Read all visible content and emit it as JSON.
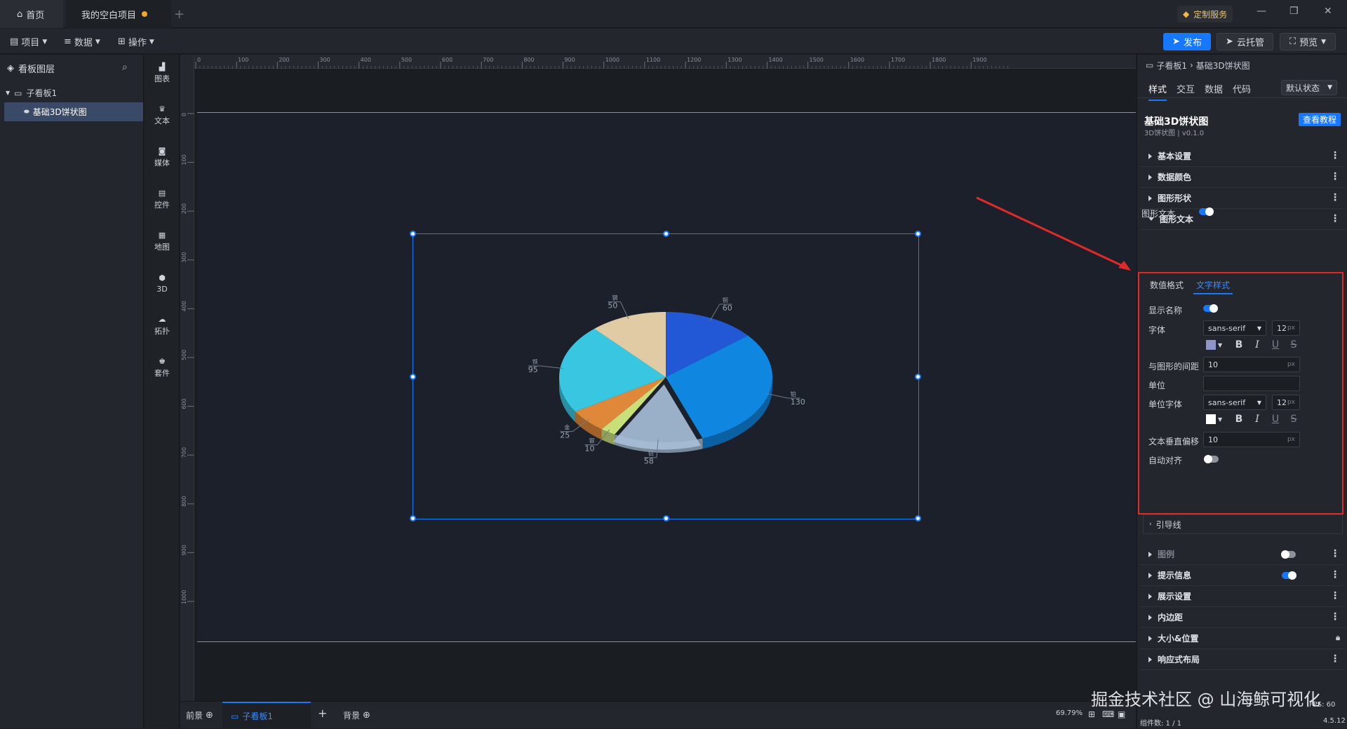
{
  "titlebar": {
    "home_tab": "首页",
    "project_tab": "我的空白项目",
    "custom_service": "定制服务"
  },
  "toolbar": {
    "menus": [
      "项目",
      "数据",
      "操作"
    ],
    "publish": "发布",
    "cloud": "云托管",
    "preview": "预览"
  },
  "layers": {
    "title": "看板图层",
    "board": "子看板1",
    "item": "基础3D饼状图"
  },
  "components": [
    "图表",
    "文本",
    "媒体",
    "控件",
    "地图",
    "3D",
    "拓扑",
    "套件"
  ],
  "ruler": {
    "h_ticks": [
      "0",
      "100",
      "200",
      "300",
      "400",
      "500",
      "600",
      "700",
      "800",
      "900",
      "1000",
      "1100",
      "1200",
      "1300",
      "1400",
      "1500",
      "1600",
      "1700",
      "1800",
      "1900"
    ],
    "v_ticks": [
      "0",
      "100",
      "200",
      "300",
      "400",
      "500",
      "600",
      "700",
      "800",
      "900",
      "1000"
    ]
  },
  "chart_data": {
    "type": "pie",
    "variant": "3d",
    "slices": [
      {
        "name": "铜",
        "value": 60,
        "color": "#2257d6"
      },
      {
        "name": "铂",
        "value": 130,
        "color": "#0f86e0"
      },
      {
        "name": "钻",
        "value": 58,
        "color": "#a8bfd9"
      },
      {
        "name": "银",
        "value": 10,
        "color": "#c9e07a"
      },
      {
        "name": "金",
        "value": 25,
        "color": "#e0883a"
      },
      {
        "name": "铁",
        "value": 95,
        "color": "#38c6e0"
      },
      {
        "name": "钢",
        "value": 50,
        "color": "#e1cba4"
      }
    ]
  },
  "bottombar": {
    "foreground": "前景",
    "board": "子看板1",
    "add": "+",
    "background": "背景",
    "zoom": "69.79%",
    "components_count": "组件数: 1 / 1",
    "version": "4.5.12",
    "fps": "FPS: 60"
  },
  "panel": {
    "breadcrumb_root": "子看板1",
    "breadcrumb_item": "基础3D饼状图",
    "tabs": [
      "样式",
      "交互",
      "数据",
      "代码"
    ],
    "state": "默认状态",
    "title": "基础3D饼状图",
    "subtitle": "3D饼状图 | v0.1.0",
    "tutorial": "查看教程",
    "sections_top": [
      "基本设置",
      "数据颜色",
      "图形形状",
      "图形文本"
    ],
    "graph_text_label": "图形文本",
    "inner_tabs": [
      "数值格式",
      "文字样式"
    ],
    "show_name": "显示名称",
    "font_label": "字体",
    "font_value": "sans-serif",
    "font_size": "12",
    "unit_px": "px",
    "gap_label": "与图形的间距",
    "gap_value": "10",
    "unit_label": "单位",
    "unit_value": "",
    "unit_font_label": "单位字体",
    "unit_font_value": "sans-serif",
    "unit_font_size": "12",
    "offset_label": "文本垂直偏移",
    "offset_value": "10",
    "auto_align": "自动对齐",
    "guide": "引导线",
    "sections_bottom": [
      "图例",
      "提示信息",
      "展示设置",
      "内边距",
      "大小&位置",
      "响应式布局"
    ],
    "label_color": "#8f95c8",
    "unit_color": "#ffffff"
  },
  "watermark": "掘金技术社区 @ 山海鲸可视化"
}
